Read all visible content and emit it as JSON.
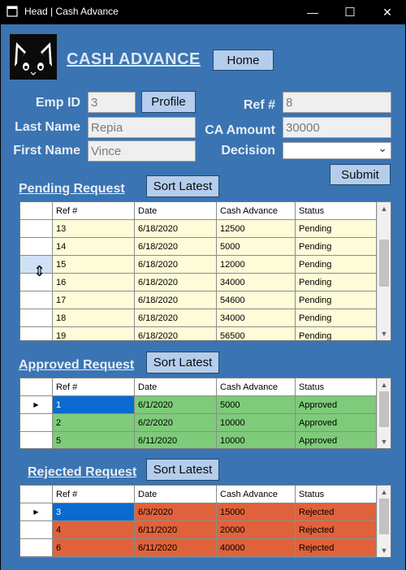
{
  "window": {
    "title": "Head | Cash Advance",
    "minimize_glyph": "—",
    "maximize_glyph": "☐",
    "close_glyph": "✕"
  },
  "header": {
    "app_title": "CASH ADVANCE",
    "home_label": "Home"
  },
  "form": {
    "emp_id_label": "Emp ID",
    "emp_id_value": "3",
    "profile_label": "Profile",
    "last_name_label": "Last Name",
    "last_name_value": "Repia",
    "first_name_label": "First Name",
    "first_name_value": "Vince",
    "ref_label": "Ref #",
    "ref_value": "8",
    "ca_amount_label": "CA Amount",
    "ca_amount_value": "30000",
    "decision_label": "Decision",
    "decision_value": "",
    "submit_label": "Submit"
  },
  "columns": [
    "Ref #",
    "Date",
    "Cash Advance",
    "Status"
  ],
  "pending": {
    "title": "Pending Request",
    "sort_label": "Sort Latest",
    "row_color": "#fdfbd8",
    "rows": [
      [
        "13",
        "6/18/2020",
        "12500",
        "Pending"
      ],
      [
        "14",
        "6/18/2020",
        "5000",
        "Pending"
      ],
      [
        "15",
        "6/18/2020",
        "12000",
        "Pending"
      ],
      [
        "16",
        "6/18/2020",
        "34000",
        "Pending"
      ],
      [
        "17",
        "6/18/2020",
        "54600",
        "Pending"
      ],
      [
        "18",
        "6/18/2020",
        "34000",
        "Pending"
      ],
      [
        "19",
        "6/18/2020",
        "56500",
        "Pending"
      ]
    ]
  },
  "approved": {
    "title": "Approved Request",
    "sort_label": "Sort Latest",
    "row_color": "#7ecb7a",
    "rows": [
      [
        "1",
        "6/1/2020",
        "5000",
        "Approved"
      ],
      [
        "2",
        "6/2/2020",
        "10000",
        "Approved"
      ],
      [
        "5",
        "6/11/2020",
        "10000",
        "Approved"
      ]
    ]
  },
  "rejected": {
    "title": "Rejected Request",
    "sort_label": "Sort Latest",
    "row_color": "#e0623a",
    "rows": [
      [
        "3",
        "6/3/2020",
        "15000",
        "Rejected"
      ],
      [
        "4",
        "6/11/2020",
        "20000",
        "Rejected"
      ],
      [
        "6",
        "6/11/2020",
        "40000",
        "Rejected"
      ]
    ]
  },
  "colors": {
    "background": "#3a74b2",
    "selected_cell": "#0a6ad0",
    "button": "#b4cdec"
  },
  "icons": {
    "row_pointer": "▶",
    "dropdown": "⌄",
    "scroll_up": "▲",
    "scroll_down": "▼",
    "resize_cursor": "⇕"
  }
}
